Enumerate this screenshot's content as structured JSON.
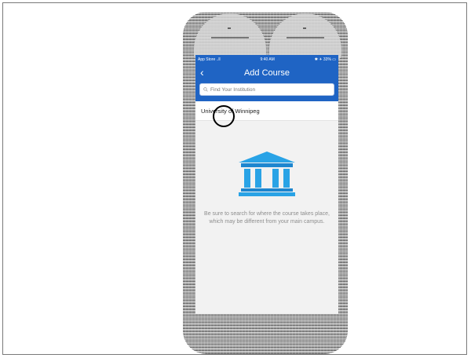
{
  "status_bar": {
    "carrier": "App Store ..ll",
    "time": "9:40 AM",
    "battery": "✱ ✈ 33% ▭"
  },
  "nav": {
    "back_icon": "chevron-left-icon",
    "title": "Add Course"
  },
  "search": {
    "placeholder": "Find Your Institution",
    "icon": "search-icon"
  },
  "results": [
    {
      "label": "University of Winnipeg"
    }
  ],
  "empty_state": {
    "icon": "institution-building-icon",
    "message": "Be sure to search for where the course takes place, which may be different from your main campus."
  },
  "colors": {
    "accent": "#1f64c4",
    "icon_blue": "#29a3e6",
    "text_muted": "#8d8d8d"
  }
}
